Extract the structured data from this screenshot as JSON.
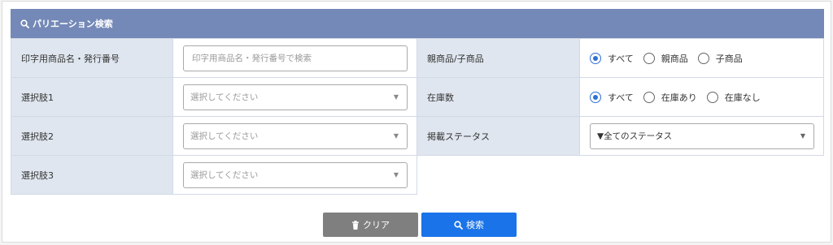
{
  "header": {
    "title": "パリエーション検索",
    "icon": "search-icon"
  },
  "fields": {
    "print_name": {
      "label": "印字用商品名・発行番号",
      "placeholder": "印字用商品名・発行番号で検索"
    },
    "option1": {
      "label": "選択肢1",
      "placeholder": "選択してください"
    },
    "option2": {
      "label": "選択肢2",
      "placeholder": "選択してください"
    },
    "option3": {
      "label": "選択肢3",
      "placeholder": "選択してください"
    },
    "parent_child": {
      "label": "親商品/子商品",
      "options": [
        "すべて",
        "親商品",
        "子商品"
      ],
      "selected": "すべて"
    },
    "stock": {
      "label": "在庫数",
      "options": [
        "すべて",
        "在庫あり",
        "在庫なし"
      ],
      "selected": "すべて"
    },
    "status": {
      "label": "掲載ステータス",
      "value": "▼全てのステータス"
    }
  },
  "buttons": {
    "clear_label": "クリア",
    "search_label": "検索"
  },
  "colors": {
    "header_bg": "#7489b7",
    "label_bg": "#dfe6ef",
    "clear_bg": "#7f7f7f",
    "search_bg": "#1a73e8",
    "radio_on": "#2f6fd6"
  }
}
